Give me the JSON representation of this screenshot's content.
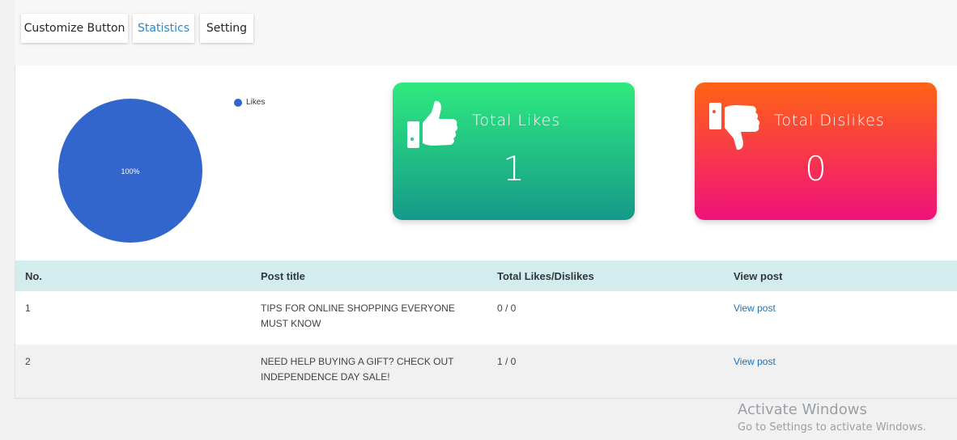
{
  "tabs": [
    {
      "label": "Customize Button",
      "active": false
    },
    {
      "label": "Statistics",
      "active": true
    },
    {
      "label": "Setting",
      "active": false
    }
  ],
  "chart_data": {
    "type": "pie",
    "labels": [
      "Likes"
    ],
    "values": [
      1
    ],
    "slice_labels": [
      "100%"
    ],
    "colors": [
      "#3366cc"
    ],
    "legend": "top-right"
  },
  "cards": {
    "likes": {
      "label": "Total Likes",
      "value": "1",
      "icon": "thumbs-up-icon",
      "gradient": [
        "#2fea7e",
        "#14998a"
      ]
    },
    "dislikes": {
      "label": "Total Dislikes",
      "value": "0",
      "icon": "thumbs-down-icon",
      "gradient": [
        "#ff6315",
        "#f0117a"
      ]
    }
  },
  "table": {
    "headers": [
      "No.",
      "Post title",
      "Total Likes/Dislikes",
      "View post"
    ],
    "rows": [
      {
        "no": "1",
        "title": "TIPS FOR ONLINE SHOPPING EVERYONE MUST KNOW",
        "total": "0 / 0",
        "view": "View post"
      },
      {
        "no": "2",
        "title": "NEED HELP BUYING A GIFT? CHECK OUT INDEPENDENCE DAY SALE!",
        "total": "1 / 0",
        "view": "View post"
      }
    ]
  },
  "watermark": {
    "title": "Activate Windows",
    "subtitle": "Go to Settings to activate Windows."
  }
}
